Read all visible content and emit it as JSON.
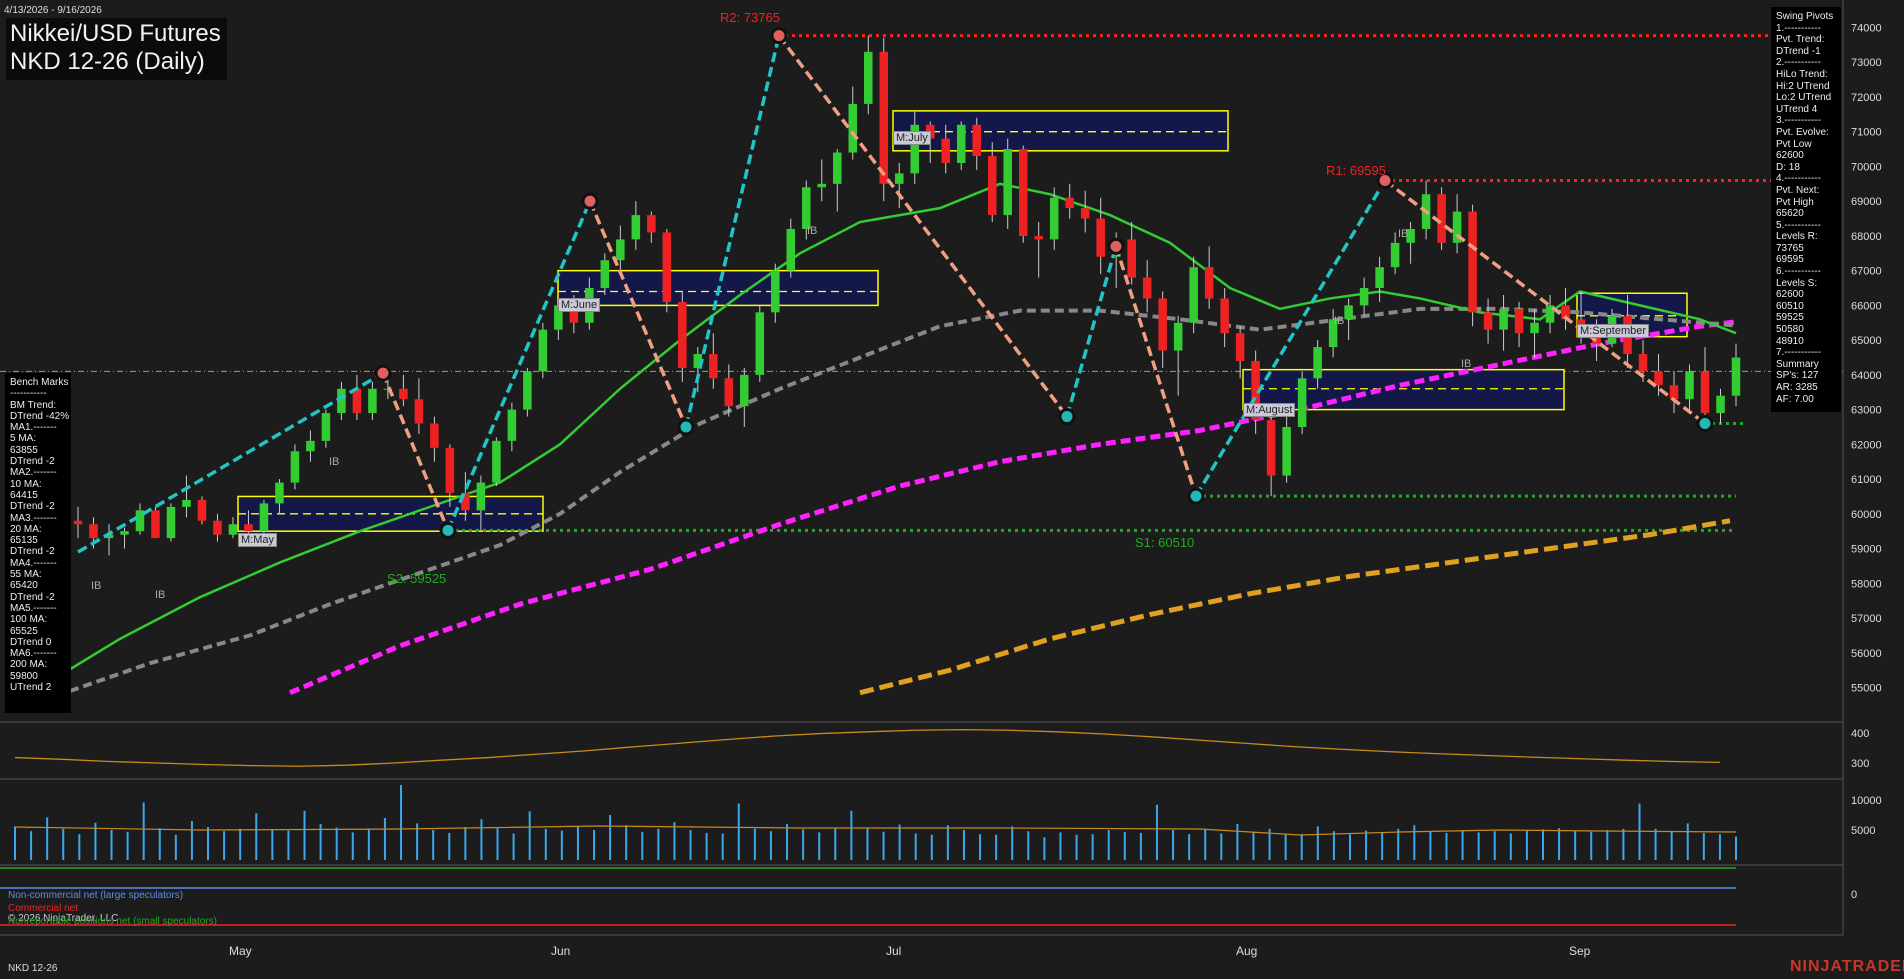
{
  "header": {
    "date_range": "4/13/2026 - 9/16/2026",
    "title_line1": "Nikkei/USD Futures",
    "title_line2": "NKD 12-26 (Daily)"
  },
  "footer": {
    "symbol": "NKD 12-26",
    "copyright": "© 2026 NinjaTrader, LLC",
    "brand": "NINJATRADER"
  },
  "bench_marks": [
    "Bench Marks",
    "-----------",
    "BM Trend:",
    "DTrend -42%",
    "MA1.-------",
    "5 MA:",
    "63855",
    "DTrend -2",
    "MA2.-------",
    "10 MA:",
    "64415",
    "DTrend -2",
    "MA3.-------",
    "20 MA:",
    "65135",
    "DTrend -2",
    "MA4.-------",
    "55 MA:",
    "65420",
    "DTrend -2",
    "MA5.-------",
    "100 MA:",
    "65525",
    "DTrend 0",
    "MA6.-------",
    "200 MA:",
    "59800",
    "UTrend 2"
  ],
  "swing_pivots": [
    "Swing Pivots",
    "1.-----------",
    "Pvt. Trend:",
    "DTrend -1",
    "2.-----------",
    "HiLo Trend:",
    "Hi:2 UTrend",
    "Lo:2 UTrend",
    "UTrend 4",
    "3.-----------",
    "Pvt. Evolve:",
    "Pvt Low",
    "62600",
    "D: 18",
    "4.-----------",
    "Pvt. Next:",
    "Pvt High",
    "65620",
    "5.-----------",
    "Levels R:",
    "73765",
    "69595",
    "6.-----------",
    "Levels S:",
    "62600",
    "60510",
    "59525",
    "50580",
    "48910",
    "7.-----------",
    "Summary",
    "SP's: 127",
    "AR: 3285",
    "AF: 7.00"
  ],
  "levels": {
    "r2": "R2: 73765",
    "r1": "R1: 69595",
    "s1": "S1: 60510",
    "s2": "S2: 59525"
  },
  "month_labels": [
    "May",
    "Jun",
    "Jul",
    "Aug",
    "Sep"
  ],
  "month_bands": [
    "M:May",
    "M:June",
    "M:July",
    "M:August",
    "M:September"
  ],
  "ib_label": "IB",
  "cot_legend": {
    "noncommercial": "Non-commercial net (large speculators)",
    "commercial": "Commercial net",
    "nonreportable": "Nonreportable positions net (small speculators)"
  },
  "colors": {
    "background": "#1c1c1c",
    "up_candle": "#33cc33",
    "down_candle": "#ee2222",
    "ma20": "#33cc33",
    "ma55": "#888888",
    "ma100": "#ff22ff",
    "ma200": "#e0a020",
    "resistance": "#ff2222",
    "support": "#22aa22",
    "swing_up": "#22c4c4",
    "swing_down": "#f0a080",
    "month_band": "#141848",
    "month_band_border": "#ffff00"
  },
  "chart_data": [
    {
      "type": "candlestick",
      "name": "price",
      "y_axis_ticks": [
        55000,
        56000,
        57000,
        58000,
        59000,
        60000,
        61000,
        62000,
        63000,
        64000,
        65000,
        66000,
        67000,
        68000,
        69000,
        70000,
        71000,
        72000,
        73000,
        74000
      ],
      "ylim": [
        54800,
        74600
      ],
      "date_range": [
        "2026-04-13",
        "2026-09-16"
      ],
      "x_tick_labels": [
        "May",
        "Jun",
        "Jul",
        "Aug",
        "Sep"
      ],
      "swing_pivots": [
        {
          "type": "low",
          "value": 58900
        },
        {
          "type": "high",
          "value": 64050
        },
        {
          "type": "low",
          "value": 59525
        },
        {
          "type": "high",
          "value": 69000
        },
        {
          "type": "low",
          "value": 62500
        },
        {
          "type": "high",
          "value": 73765
        },
        {
          "type": "low",
          "value": 62800
        },
        {
          "type": "high",
          "value": 67700
        },
        {
          "type": "low",
          "value": 60510
        },
        {
          "type": "high",
          "value": 69595
        },
        {
          "type": "low",
          "value": 62600
        }
      ],
      "resistance": [
        73765,
        69595
      ],
      "support": [
        62600,
        60510,
        59525
      ],
      "moving_averages": [
        {
          "name": "5 MA",
          "last": 63855
        },
        {
          "name": "10 MA",
          "last": 64415
        },
        {
          "name": "20 MA",
          "last": 65135
        },
        {
          "name": "55 MA",
          "last": 65420
        },
        {
          "name": "100 MA",
          "last": 65525
        },
        {
          "name": "200 MA",
          "last": 59800
        }
      ],
      "month_value_areas": [
        {
          "label": "M:May",
          "high": 60500,
          "low": 59500,
          "mid": 60000
        },
        {
          "label": "M:June",
          "high": 67000,
          "low": 66000,
          "mid": 66400
        },
        {
          "label": "M:July",
          "high": 71600,
          "low": 70450,
          "mid": 71000
        },
        {
          "label": "M:August",
          "high": 64150,
          "low": 63000,
          "mid": 63600
        },
        {
          "label": "M:September",
          "high": 66350,
          "low": 65100,
          "mid": 65700
        }
      ],
      "ohlc": [
        [
          59800,
          60200,
          59300,
          59700
        ],
        [
          59700,
          59900,
          59000,
          59300
        ],
        [
          59300,
          59700,
          58800,
          59400
        ],
        [
          59400,
          59600,
          59000,
          59500
        ],
        [
          59500,
          60300,
          59400,
          60100
        ],
        [
          60100,
          60200,
          59300,
          59300
        ],
        [
          59300,
          60300,
          59200,
          60200
        ],
        [
          60200,
          61100,
          59900,
          60400
        ],
        [
          60400,
          60500,
          59700,
          59800
        ],
        [
          59800,
          60000,
          59200,
          59400
        ],
        [
          59400,
          59900,
          59300,
          59700
        ],
        [
          59700,
          60100,
          59200,
          59500
        ],
        [
          59500,
          60400,
          59400,
          60300
        ],
        [
          60300,
          61000,
          60000,
          60900
        ],
        [
          60900,
          62000,
          60700,
          61800
        ],
        [
          61800,
          62400,
          61500,
          62100
        ],
        [
          62100,
          63000,
          61900,
          62900
        ],
        [
          62900,
          63800,
          62700,
          63600
        ],
        [
          63600,
          64000,
          62700,
          62900
        ],
        [
          62900,
          63800,
          62700,
          63600
        ],
        [
          63600,
          64000,
          63300,
          63600
        ],
        [
          63600,
          64000,
          63100,
          63300
        ],
        [
          63300,
          63900,
          62300,
          62600
        ],
        [
          62600,
          62800,
          61500,
          61900
        ],
        [
          61900,
          62000,
          60200,
          60600
        ],
        [
          60600,
          61200,
          59800,
          60100
        ],
        [
          60100,
          61100,
          59525,
          60900
        ],
        [
          60900,
          62200,
          60800,
          62100
        ],
        [
          62100,
          63200,
          61800,
          63000
        ],
        [
          63000,
          64200,
          62800,
          64100
        ],
        [
          64100,
          65500,
          63900,
          65300
        ],
        [
          65300,
          66200,
          65000,
          66000
        ],
        [
          66000,
          66300,
          65200,
          65500
        ],
        [
          65500,
          66800,
          65300,
          66500
        ],
        [
          66500,
          67500,
          66300,
          67300
        ],
        [
          67300,
          68300,
          66900,
          67900
        ],
        [
          67900,
          69000,
          67600,
          68600
        ],
        [
          68600,
          68700,
          67800,
          68100
        ],
        [
          68100,
          68200,
          65800,
          66100
        ],
        [
          66100,
          66400,
          63800,
          64200
        ],
        [
          64200,
          64800,
          63500,
          64600
        ],
        [
          64600,
          65200,
          63600,
          63900
        ],
        [
          63900,
          64300,
          62800,
          63100
        ],
        [
          63100,
          64200,
          62500,
          64000
        ],
        [
          64000,
          66000,
          63800,
          65800
        ],
        [
          65800,
          67200,
          65500,
          67000
        ],
        [
          67000,
          68500,
          66800,
          68200
        ],
        [
          68200,
          69600,
          67900,
          69400
        ],
        [
          69400,
          70200,
          69000,
          69500
        ],
        [
          69500,
          70500,
          68700,
          70400
        ],
        [
          70400,
          72300,
          70200,
          71800
        ],
        [
          71800,
          73765,
          71500,
          73300
        ],
        [
          73300,
          73700,
          69000,
          69500
        ],
        [
          69500,
          70100,
          68800,
          69800
        ],
        [
          69800,
          71600,
          69500,
          71200
        ],
        [
          71200,
          71300,
          70100,
          70800
        ],
        [
          70800,
          71200,
          69800,
          70100
        ],
        [
          70100,
          71300,
          69900,
          71200
        ],
        [
          71200,
          71400,
          69900,
          70300
        ],
        [
          70300,
          70700,
          68400,
          68600
        ],
        [
          68600,
          70800,
          68200,
          70500
        ],
        [
          70500,
          70600,
          67800,
          68000
        ],
        [
          68000,
          68400,
          66800,
          67900
        ],
        [
          67900,
          69400,
          67600,
          69100
        ],
        [
          69100,
          69500,
          68500,
          68800
        ],
        [
          68800,
          69300,
          68100,
          68500
        ],
        [
          68500,
          69100,
          66900,
          67400
        ],
        [
          67400,
          68100,
          66500,
          67900
        ],
        [
          67900,
          68400,
          66600,
          66800
        ],
        [
          66800,
          67300,
          65800,
          66200
        ],
        [
          66200,
          66400,
          64200,
          64700
        ],
        [
          64700,
          65700,
          63400,
          65500
        ],
        [
          65500,
          67400,
          65200,
          67100
        ],
        [
          67100,
          67700,
          65900,
          66200
        ],
        [
          66200,
          66500,
          64800,
          65200
        ],
        [
          65200,
          65400,
          63900,
          64400
        ],
        [
          64400,
          64700,
          62300,
          62700
        ],
        [
          62700,
          62900,
          60510,
          61100
        ],
        [
          61100,
          62800,
          60900,
          62500
        ],
        [
          62500,
          64100,
          62300,
          63900
        ],
        [
          63900,
          65000,
          63600,
          64800
        ],
        [
          64800,
          65900,
          64500,
          65600
        ],
        [
          65600,
          66200,
          65000,
          66000
        ],
        [
          66000,
          66800,
          65700,
          66500
        ],
        [
          66500,
          67400,
          66100,
          67100
        ],
        [
          67100,
          68100,
          66900,
          67800
        ],
        [
          67800,
          68400,
          67200,
          68200
        ],
        [
          68200,
          69595,
          67900,
          69200
        ],
        [
          69200,
          69400,
          67600,
          67800
        ],
        [
          67800,
          69200,
          67500,
          68700
        ],
        [
          68700,
          68900,
          65400,
          65800
        ],
        [
          65800,
          66200,
          64900,
          65300
        ],
        [
          65300,
          66300,
          64700,
          65900
        ],
        [
          65900,
          66100,
          64800,
          65200
        ],
        [
          65200,
          65900,
          64500,
          65500
        ],
        [
          65500,
          66300,
          65200,
          66000
        ],
        [
          66000,
          66500,
          65300,
          65600
        ],
        [
          65600,
          66400,
          64900,
          65100
        ],
        [
          65100,
          65600,
          64400,
          64900
        ],
        [
          64900,
          65900,
          64800,
          65700
        ],
        [
          65700,
          66300,
          64200,
          64600
        ],
        [
          64600,
          65000,
          63800,
          64100
        ],
        [
          64100,
          64600,
          63400,
          63700
        ],
        [
          63700,
          64100,
          62900,
          63300
        ],
        [
          63300,
          64300,
          63000,
          64100
        ],
        [
          64100,
          64800,
          62600,
          62900
        ],
        [
          62900,
          63600,
          62600,
          63400
        ],
        [
          63400,
          64900,
          63100,
          64500
        ]
      ]
    },
    {
      "type": "line",
      "name": "ATR",
      "y_axis_ticks": [
        300,
        400
      ],
      "values": [
        330,
        322,
        312,
        305,
        298,
        293,
        290,
        295,
        305,
        318,
        330,
        345,
        360,
        378,
        395,
        412,
        428,
        440,
        448,
        455,
        458,
        455,
        448,
        438,
        425,
        410,
        395,
        380,
        368,
        357,
        348,
        340,
        332,
        325,
        318,
        312,
        308
      ]
    },
    {
      "type": "bar",
      "name": "Volume",
      "y_axis_ticks": [
        5000,
        10000
      ],
      "values": [
        5600,
        4800,
        7100,
        5200,
        4300,
        6200,
        5000,
        4700,
        9600,
        5300,
        4200,
        6500,
        5500,
        4800,
        5200,
        7800,
        5100,
        4900,
        8200,
        6000,
        5400,
        4600,
        5200,
        7000,
        12500,
        6100,
        5000,
        4500,
        5500,
        6800,
        5300,
        4400,
        8100,
        5200,
        4900,
        5600,
        5000,
        7500,
        5800,
        4700,
        5200,
        6300,
        5000,
        4500,
        4400,
        9400,
        5200,
        4800,
        6000,
        5100,
        4600,
        5300,
        8200,
        5400,
        4700,
        5900,
        4400,
        4200,
        5800,
        5000,
        4300,
        4200,
        5600,
        4800,
        3800,
        4600,
        4200,
        4300,
        5000,
        4700,
        4500,
        9200,
        5000,
        4300,
        5200,
        4400,
        6000,
        4700,
        5200,
        4400,
        4300,
        5600,
        4800,
        4300,
        4900,
        4500,
        5200,
        5800,
        4800,
        4500,
        4900,
        4600,
        4800,
        4400,
        4900,
        5100,
        5300,
        4900,
        4700,
        5000,
        5200,
        9400,
        5200,
        4700,
        6100,
        4500,
        4300,
        3900
      ]
    },
    {
      "type": "line",
      "name": "COT",
      "y_axis_ticks": [
        0
      ],
      "series": [
        {
          "name": "Non-commercial net (large speculators)",
          "values": [
            0
          ]
        },
        {
          "name": "Commercial net",
          "values": [
            0
          ]
        },
        {
          "name": "Nonreportable positions net (small speculators)",
          "values": [
            0
          ]
        }
      ]
    }
  ]
}
